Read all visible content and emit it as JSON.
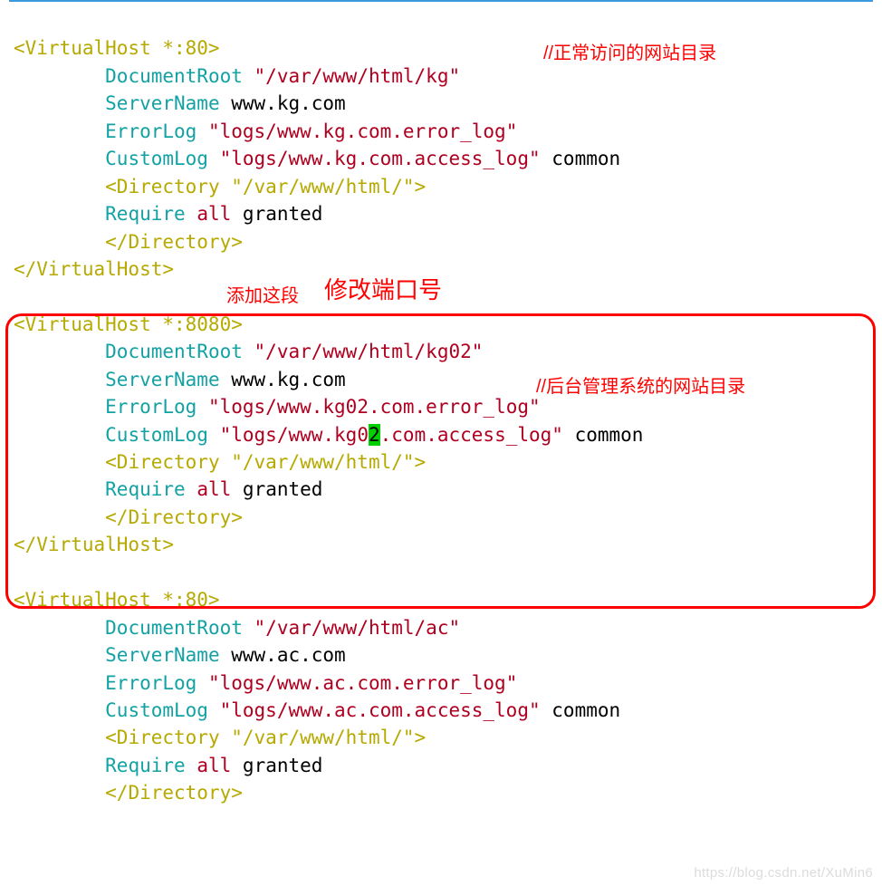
{
  "annotations": {
    "a1": "//正常访问的网站目录",
    "a2_small": "添加这段",
    "a2_big": "修改端口号",
    "a3": "//后台管理系统的网站目录"
  },
  "watermark": "https://blog.csdn.net/XuMin6",
  "b1": {
    "open": "<VirtualHost *:80>",
    "dr_key": "DocumentRoot",
    "dr_val": "\"/var/www/html/kg\"",
    "sn_key": "ServerName",
    "sn_val": "www.kg.com",
    "el_key": "ErrorLog",
    "el_val": "\"logs/www.kg.com.error_log\"",
    "cl_key": "CustomLog",
    "cl_val": "\"logs/www.kg.com.access_log\"",
    "cl_tail": "common",
    "dir_open": "<Directory \"/var/www/html/\">",
    "req_key": "Require",
    "req_kw": "all",
    "req_val": "granted",
    "dir_close": "</Directory>",
    "close": "</VirtualHost>"
  },
  "b2": {
    "open": "<VirtualHost *:8080>",
    "dr_key": "DocumentRoot",
    "dr_val": "\"/var/www/html/kg02\"",
    "sn_key": "ServerName",
    "sn_val": "www.kg.com",
    "el_key": "ErrorLog",
    "el_val": "\"logs/www.kg02.com.error_log\"",
    "cl_key": "CustomLog",
    "cl_val_a": "\"logs/www.kg0",
    "cl_val_cursor": "2",
    "cl_val_b": ".com.access_log\"",
    "cl_tail": "common",
    "dir_open": "<Directory \"/var/www/html/\">",
    "req_key": "Require",
    "req_kw": "all",
    "req_val": "granted",
    "dir_close": "</Directory>",
    "close": "</VirtualHost>"
  },
  "b3": {
    "open": "<VirtualHost *:80>",
    "dr_key": "DocumentRoot",
    "dr_val": "\"/var/www/html/ac\"",
    "sn_key": "ServerName",
    "sn_val": "www.ac.com",
    "el_key": "ErrorLog",
    "el_val": "\"logs/www.ac.com.error_log\"",
    "cl_key": "CustomLog",
    "cl_val": "\"logs/www.ac.com.access_log\"",
    "cl_tail": "common",
    "dir_open": "<Directory \"/var/www/html/\">",
    "req_key": "Require",
    "req_kw": "all",
    "req_val": "granted",
    "dir_close": "</Directory>"
  }
}
